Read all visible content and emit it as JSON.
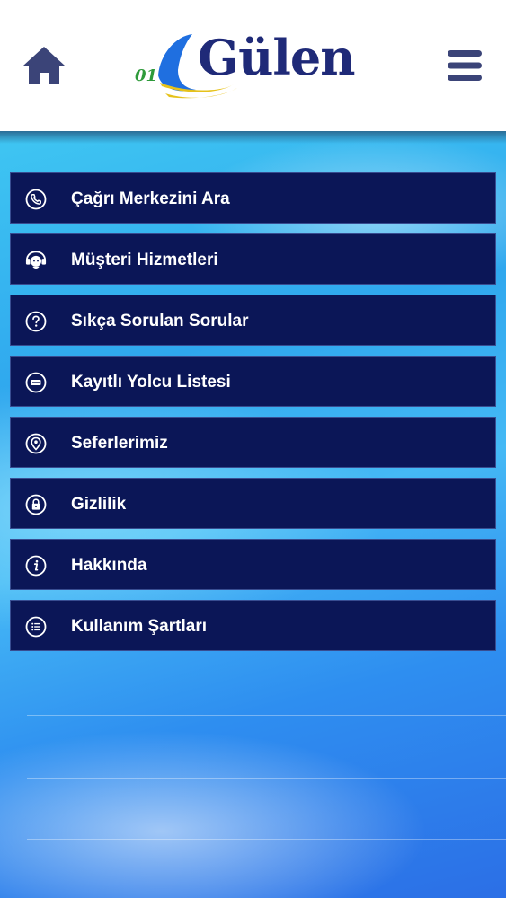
{
  "header": {
    "brand": "Gülen",
    "home_icon": "home-icon",
    "menu_icon": "hamburger-menu-icon"
  },
  "colors": {
    "brand_navy": "#1f2a78",
    "logo_blue": "#1f6fe0",
    "logo_yellow": "#e6c21a",
    "logo_green": "#2e9a3a",
    "menu_item_bg": "#0b1657",
    "header_icon": "#3b4478"
  },
  "menu": {
    "items": [
      {
        "label": "Çağrı Merkezini Ara",
        "icon": "phone-icon"
      },
      {
        "label": "Müşteri Hizmetleri",
        "icon": "support-agent-icon"
      },
      {
        "label": "Sıkça Sorulan Sorular",
        "icon": "question-icon"
      },
      {
        "label": "Kayıtlı Yolcu Listesi",
        "icon": "passenger-list-icon"
      },
      {
        "label": "Seferlerimiz",
        "icon": "location-pin-icon"
      },
      {
        "label": "Gizlilik",
        "icon": "lock-icon"
      },
      {
        "label": "Hakkında",
        "icon": "info-icon"
      },
      {
        "label": "Kullanım Şartları",
        "icon": "list-icon"
      }
    ]
  }
}
